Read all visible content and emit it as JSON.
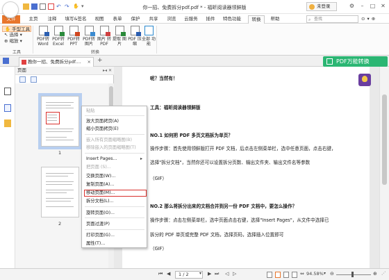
{
  "window": {
    "title": "你一招、免费拆分pdf.pdf * - 福昕阅读器领鲜版",
    "login": "未登录"
  },
  "tabs": [
    "文件",
    "主页",
    "注释",
    "填写&签名",
    "视图",
    "表单",
    "保护",
    "共享",
    "浏览",
    "云服务",
    "插件",
    "特色功能",
    "转换",
    "帮助"
  ],
  "search": {
    "placeholder": "查找"
  },
  "ribbon": {
    "tools_group": {
      "items": [
        "手型工具",
        "选择",
        "缩放"
      ],
      "label": "工具"
    },
    "convert_group": {
      "buttons": [
        {
          "label": "PDF转 Word",
          "icon": "pdf-to-word-icon",
          "color": "#2b5eb0"
        },
        {
          "label": "PDF转 Excel",
          "icon": "pdf-to-excel-icon",
          "color": "#2a8a3a"
        },
        {
          "label": "PDF转 PPT",
          "icon": "pdf-to-ppt-icon",
          "color": "#d0461e"
        },
        {
          "label": "PDF转 图片",
          "icon": "pdf-to-image-icon",
          "color": "#3a8ad0"
        },
        {
          "label": "图片 转PDF",
          "icon": "image-to-pdf-icon",
          "color": "#d04040"
        },
        {
          "label": "提取 图片",
          "icon": "extract-image-icon",
          "color": "#2a8a3a"
        },
        {
          "label": "PDF 压缩",
          "icon": "pdf-compress-icon",
          "color": "#2b5eb0"
        },
        {
          "label": "全部 功能",
          "icon": "all-features-icon",
          "color": "#2b8ad0"
        }
      ],
      "label": "转换"
    }
  },
  "doc_tab": {
    "name": "教你一招、免费拆分pdf...."
  },
  "pdf_convert_button": "PDF万能转换",
  "page_panel": {
    "title": "页面",
    "thumbnails": [
      {
        "number": "1"
      },
      {
        "number": "2"
      }
    ]
  },
  "context_menu": {
    "items": [
      {
        "label": "粘贴",
        "enabled": false
      },
      {
        "label": "放大页面拷页(A)",
        "enabled": true
      },
      {
        "label": "缩小页面拷页(E)",
        "enabled": true
      },
      {
        "label": "嵌入所有页面缩略图(B)",
        "enabled": false
      },
      {
        "label": "移除嵌入的页面缩略图(T)",
        "enabled": false
      },
      {
        "label": "Insert Pages...",
        "enabled": true
      },
      {
        "label": "把页面 (S)...",
        "enabled": false
      },
      {
        "label": "交换页面(W)...",
        "enabled": true
      },
      {
        "label": "复制页面(A)...",
        "enabled": true
      },
      {
        "label": "移动页面(M)...",
        "enabled": true
      },
      {
        "label": "拆分文档(L)...",
        "enabled": true
      },
      {
        "label": "旋转页面(O)...",
        "enabled": true
      },
      {
        "label": "页面过渡(P)",
        "enabled": true
      },
      {
        "label": "打印页面(G)...",
        "enabled": true
      },
      {
        "label": "属性(T)...",
        "enabled": true
      }
    ],
    "highlighted": "移动页面(M)..."
  },
  "document": {
    "lines": [
      {
        "text": "呢？当然有！",
        "bold": true
      },
      {
        "text": "工具：福昕阅读器领鲜版",
        "bold": true
      },
      {
        "text": "NO.1 如何把 PDF 多页文档拆为单页？",
        "bold": true
      },
      {
        "text": "操作步骤：首先使用领鲜版打开 PDF 文档，后点击左侧菜单栏，选中任意页面，点击右键，",
        "bold": false
      },
      {
        "text": "选择\"拆分文档\"，当然你还可以设置拆分页数、输出文件夹、输出文件名等参数",
        "bold": false
      },
      {
        "text": "（GIF）",
        "bold": false
      },
      {
        "text": "NO.2 那么将拆分出来的文档合并到另一份 PDF 文档中，要怎么操作？",
        "bold": true
      },
      {
        "text": "操作步骤：点击左侧菜单栏，选中页面点击右键，选择\"Insert Pages\"，从文件中选择已",
        "bold": false
      },
      {
        "text": "拆分的 PDF 单页或完整 PDF 文档，选择页码，选择插入位置即可",
        "bold": false
      },
      {
        "text": "（GIF）",
        "bold": false
      }
    ]
  },
  "statusbar": {
    "page_value": "1 / 2",
    "zoom": "94.58%"
  },
  "colors": {
    "accent": "#e8762c",
    "highlight_red": "#d9302c",
    "convert_green": "#2bb673",
    "selection_blue": "#b8cff0"
  }
}
